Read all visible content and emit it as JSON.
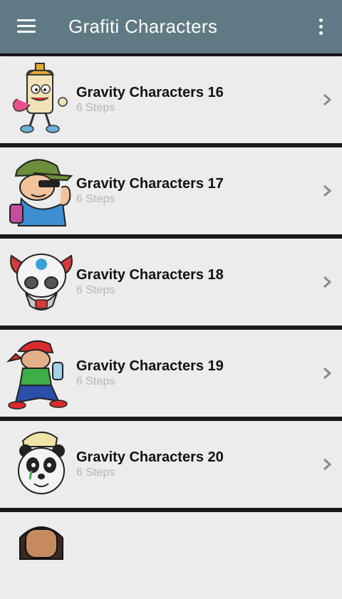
{
  "appbar": {
    "title": "Grafiti Characters",
    "menu_icon": "hamburger-menu-icon",
    "overflow_icon": "more-vert-icon",
    "background": "#5f7a84"
  },
  "items": [
    {
      "title": "Gravity Characters 16",
      "subtitle": "6 Steps",
      "thumb": "spray-can-character"
    },
    {
      "title": "Gravity Characters 17",
      "subtitle": "6 Steps",
      "thumb": "cap-boy-character"
    },
    {
      "title": "Gravity Characters 18",
      "subtitle": "6 Steps",
      "thumb": "skull-gasmask-character"
    },
    {
      "title": "Gravity Characters 19",
      "subtitle": "6 Steps",
      "thumb": "red-cap-boy-character"
    },
    {
      "title": "Gravity Characters 20",
      "subtitle": "6 Steps",
      "thumb": "panda-character"
    },
    {
      "title": "",
      "subtitle": "",
      "thumb": "head-character"
    }
  ]
}
